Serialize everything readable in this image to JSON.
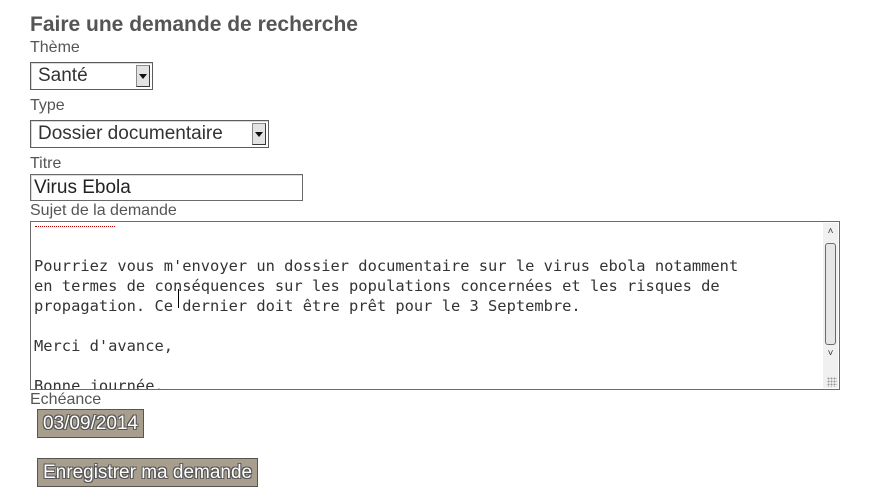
{
  "form": {
    "title": "Faire une demande de recherche",
    "theme_label": "Thème",
    "theme_value": "Santé",
    "type_label": "Type",
    "type_value": "Dossier documentaire",
    "titre_label": "Titre",
    "titre_value": "Virus Ebola",
    "sujet_label": "Sujet de la demande",
    "sujet_lines": [
      "",
      "Pourriez vous m'envoyer un dossier documentaire sur le virus ebola notamment",
      "en termes de conséquences sur les populations concernées et les risques de",
      "propagation. Ce dernier doit être prêt pour le 3 Septembre.",
      "",
      "Merci d'avance,",
      "",
      "Bonne journée."
    ],
    "echeance_label": "Echéance",
    "echeance_value": "03/09/2014",
    "submit_label": "Enregistrer ma demande"
  },
  "icons": {
    "select_arrow": "chevron-down-icon",
    "scroll_up": "chevron-up-icon",
    "scroll_down": "chevron-down-icon",
    "resize": "resize-grip-icon"
  },
  "colors": {
    "text": "#555555",
    "button_bg": "#a79e8d",
    "spellcheck_underline": "#c00000"
  }
}
